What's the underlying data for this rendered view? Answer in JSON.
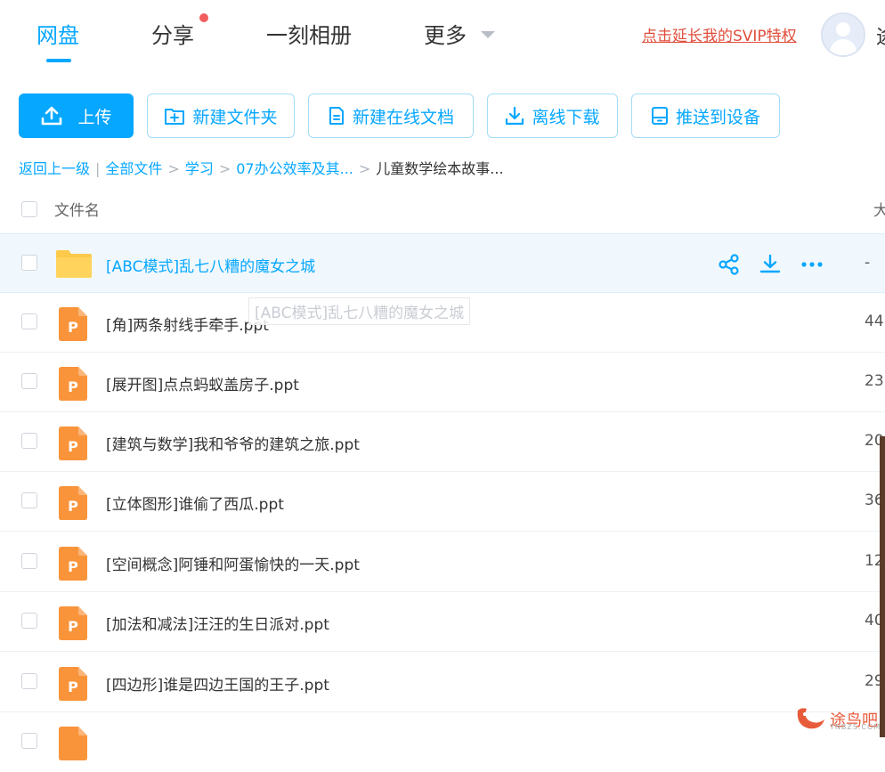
{
  "nav": {
    "tabs": [
      "网盘",
      "分享",
      "一刻相册",
      "更多"
    ],
    "svip_link": "点击延长我的SVIP特权",
    "user_name_partial": "途"
  },
  "toolbar": {
    "upload": "上传",
    "new_folder": "新建文件夹",
    "new_doc": "新建在线文档",
    "offline_download": "离线下载",
    "push_device": "推送到设备"
  },
  "breadcrumb": {
    "back": "返回上一级",
    "divider": "|",
    "sep": ">",
    "items": [
      "全部文件",
      "学习",
      "07办公效率及其...",
      "儿童数学绘本故事..."
    ]
  },
  "table": {
    "col_name": "文件名",
    "col_size_partial": "大",
    "rows": [
      {
        "name": "[ABC模式]乱七八糟的魔女之城",
        "size": "-",
        "type": "folder"
      },
      {
        "name": "[角]两条射线手牵手.ppt",
        "size": "44.",
        "type": "ppt"
      },
      {
        "name": "[展开图]点点蚂蚁盖房子.ppt",
        "size": "23.",
        "type": "ppt"
      },
      {
        "name": "[建筑与数学]我和爷爷的建筑之旅.ppt",
        "size": "20.",
        "type": "ppt"
      },
      {
        "name": "[立体图形]谁偷了西瓜.ppt",
        "size": "36.",
        "type": "ppt"
      },
      {
        "name": "[空间概念]阿锤和阿蛋愉快的一天.ppt",
        "size": "12",
        "type": "ppt"
      },
      {
        "name": "[加法和减法]汪汪的生日派对.ppt",
        "size": "40.",
        "type": "ppt"
      },
      {
        "name": "[四边形]谁是四边王国的王子.ppt",
        "size": "29.",
        "type": "ppt"
      },
      {
        "name": "",
        "size": "",
        "type": "ppt"
      }
    ],
    "ppt_letter": "P"
  },
  "tooltip": "[ABC模式]乱七八糟的魔女之城",
  "watermark": {
    "text": "途鸟吧",
    "sub": "TNBZS.COM"
  },
  "colors": {
    "accent": "#06a7ff",
    "svip": "#e04d3b",
    "ppt": "#f9943b",
    "folder": "#fcc94a"
  }
}
